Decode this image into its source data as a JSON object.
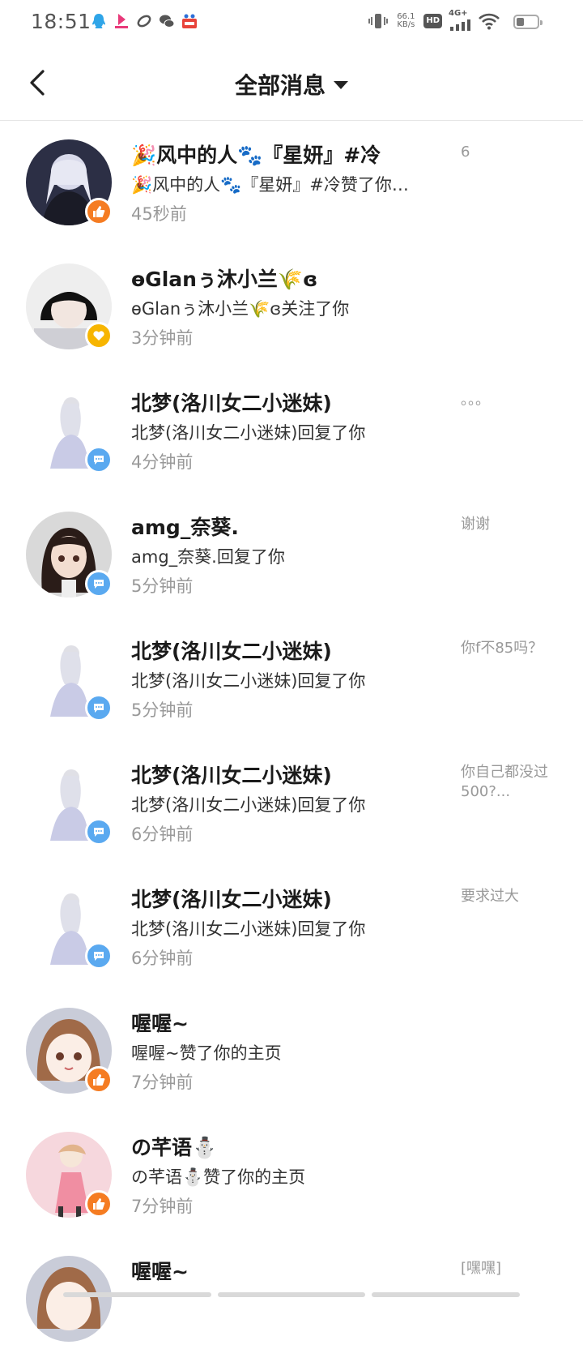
{
  "status_bar": {
    "time": "18:51",
    "net_speed_value": "66.1",
    "net_speed_unit": "KB/s",
    "hd": "HD",
    "network": "4G+",
    "app_icons": [
      "qq-icon",
      "app-icon",
      "link-icon",
      "wechat-icon",
      "baidu-icon"
    ]
  },
  "header": {
    "title": "全部消息"
  },
  "colors": {
    "like_badge": "#f57c22",
    "follow_badge": "#f7b500",
    "reply_badge": "#5aa9f0"
  },
  "messages": [
    {
      "name": "🎉风中的人🐾『星妍』#冷",
      "desc": "🎉风中的人🐾『星妍』#冷赞了你…",
      "time": "45秒前",
      "preview": "6",
      "badge": "like-icon"
    },
    {
      "name": "ɵGlanぅ沐小兰🌾ɞ",
      "desc": "ɵGlanぅ沐小兰🌾ɞ关注了你",
      "time": "3分钟前",
      "preview": "",
      "badge": "heart-icon"
    },
    {
      "name": "北梦(洛川女二小迷妹)",
      "desc": "北梦(洛川女二小迷妹)回复了你",
      "time": "4分钟前",
      "preview": "。。。",
      "badge": "chat-icon"
    },
    {
      "name": "amg_奈葵.",
      "desc": "amg_奈葵.回复了你",
      "time": "5分钟前",
      "preview": "谢谢",
      "badge": "chat-icon"
    },
    {
      "name": "北梦(洛川女二小迷妹)",
      "desc": "北梦(洛川女二小迷妹)回复了你",
      "time": "5分钟前",
      "preview": "你f不85吗？",
      "badge": "chat-icon"
    },
    {
      "name": "北梦(洛川女二小迷妹)",
      "desc": "北梦(洛川女二小迷妹)回复了你",
      "time": "6分钟前",
      "preview": "你自己都没过500?...",
      "badge": "chat-icon"
    },
    {
      "name": "北梦(洛川女二小迷妹)",
      "desc": "北梦(洛川女二小迷妹)回复了你",
      "time": "6分钟前",
      "preview": "要求过大",
      "badge": "chat-icon"
    },
    {
      "name": "喔喔~",
      "desc": "喔喔~赞了你的主页",
      "time": "7分钟前",
      "preview": "",
      "badge": "like-icon"
    },
    {
      "name": "の芊语⛄",
      "desc": "の芊语⛄赞了你的主页",
      "time": "7分钟前",
      "preview": "",
      "badge": "like-icon"
    },
    {
      "name": "喔喔~",
      "desc": "",
      "time": "",
      "preview": "[嘿嘿]",
      "badge": ""
    }
  ]
}
